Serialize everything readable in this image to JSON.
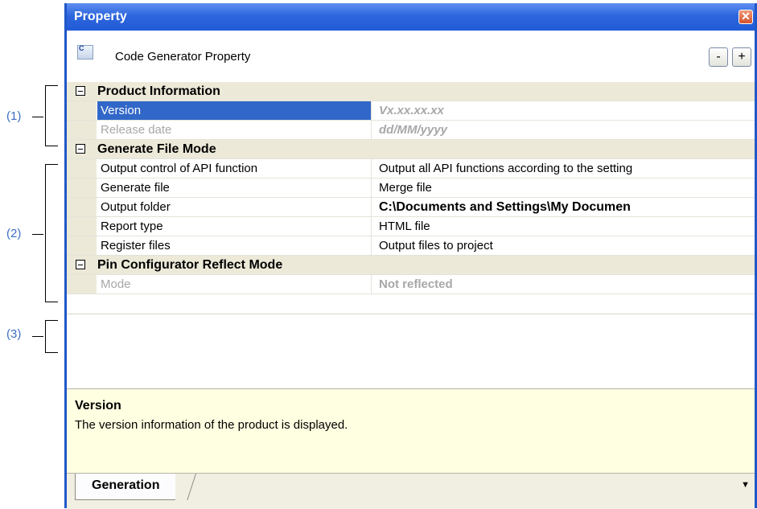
{
  "callouts": [
    "(1)",
    "(2)",
    "(3)"
  ],
  "window": {
    "title": "Property",
    "close_symbol": "✕",
    "toolbar_label": "Code Generator Property",
    "toolbar_icon": "code-generator-icon",
    "collapse_label": "-",
    "expand_label": "+"
  },
  "grid": {
    "categories": [
      {
        "name": "Product Information",
        "rows": [
          {
            "name": "Version",
            "value": "Vx.xx.xx.xx",
            "state": "selected"
          },
          {
            "name": "Release date",
            "value": "dd/MM/yyyy",
            "state": "disabled"
          }
        ]
      },
      {
        "name": "Generate File Mode",
        "rows": [
          {
            "name": "Output control of API function",
            "value": "Output all API functions according to the setting",
            "state": "normal"
          },
          {
            "name": "Generate file",
            "value": "Merge file",
            "state": "normal"
          },
          {
            "name": "Output folder",
            "value": "C:\\Documents and Settings\\My Documen",
            "state": "bold"
          },
          {
            "name": "Report type",
            "value": "HTML file",
            "state": "normal"
          },
          {
            "name": "Register files",
            "value": "Output files to project",
            "state": "normal"
          }
        ]
      },
      {
        "name": "Pin Configurator Reflect Mode",
        "rows": [
          {
            "name": "Mode",
            "value": "Not reflected",
            "state": "disabled-bold"
          }
        ]
      }
    ]
  },
  "description": {
    "title": "Version",
    "text": "The version information of the product is displayed."
  },
  "tabs": {
    "active": "Generation",
    "menu_symbol": "▼"
  }
}
